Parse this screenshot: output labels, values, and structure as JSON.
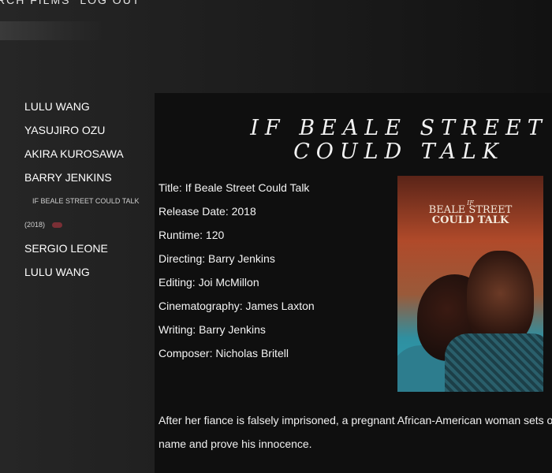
{
  "top_nav": {
    "search_label": "RCH FILMS",
    "logout_label": "LOG OUT"
  },
  "sidebar": {
    "items": [
      {
        "label": "LULU WANG"
      },
      {
        "label": "YASUJIRO OZU"
      },
      {
        "label": "AKIRA KUROSAWA"
      },
      {
        "label": "BARRY JENKINS"
      }
    ],
    "sub_film": "IF BEALE STREET COULD TALK",
    "sub_year": "(2018)",
    "items_after": [
      {
        "label": "SERGIO LEONE"
      },
      {
        "label": "LULU WANG"
      }
    ],
    "accent_color": "#7a2f35"
  },
  "movie": {
    "heading": "IF BEALE STREET COULD TALK",
    "details": [
      "Title: If Beale Street Could Talk",
      "Release Date: 2018",
      "Runtime: 120",
      "Directing: Barry Jenkins",
      "Editing: Joi McMillon",
      "Cinematography: James Laxton",
      "Writing: Barry Jenkins",
      "Composer: Nicholas Britell"
    ],
    "poster": {
      "if": "IF",
      "beale": "BEALE STREET",
      "could": "COULD TALK"
    },
    "synopsis_line1": "After her fiance is falsely imprisoned, a pregnant African-American woman sets o",
    "synopsis_line2": "name and prove his innocence."
  }
}
